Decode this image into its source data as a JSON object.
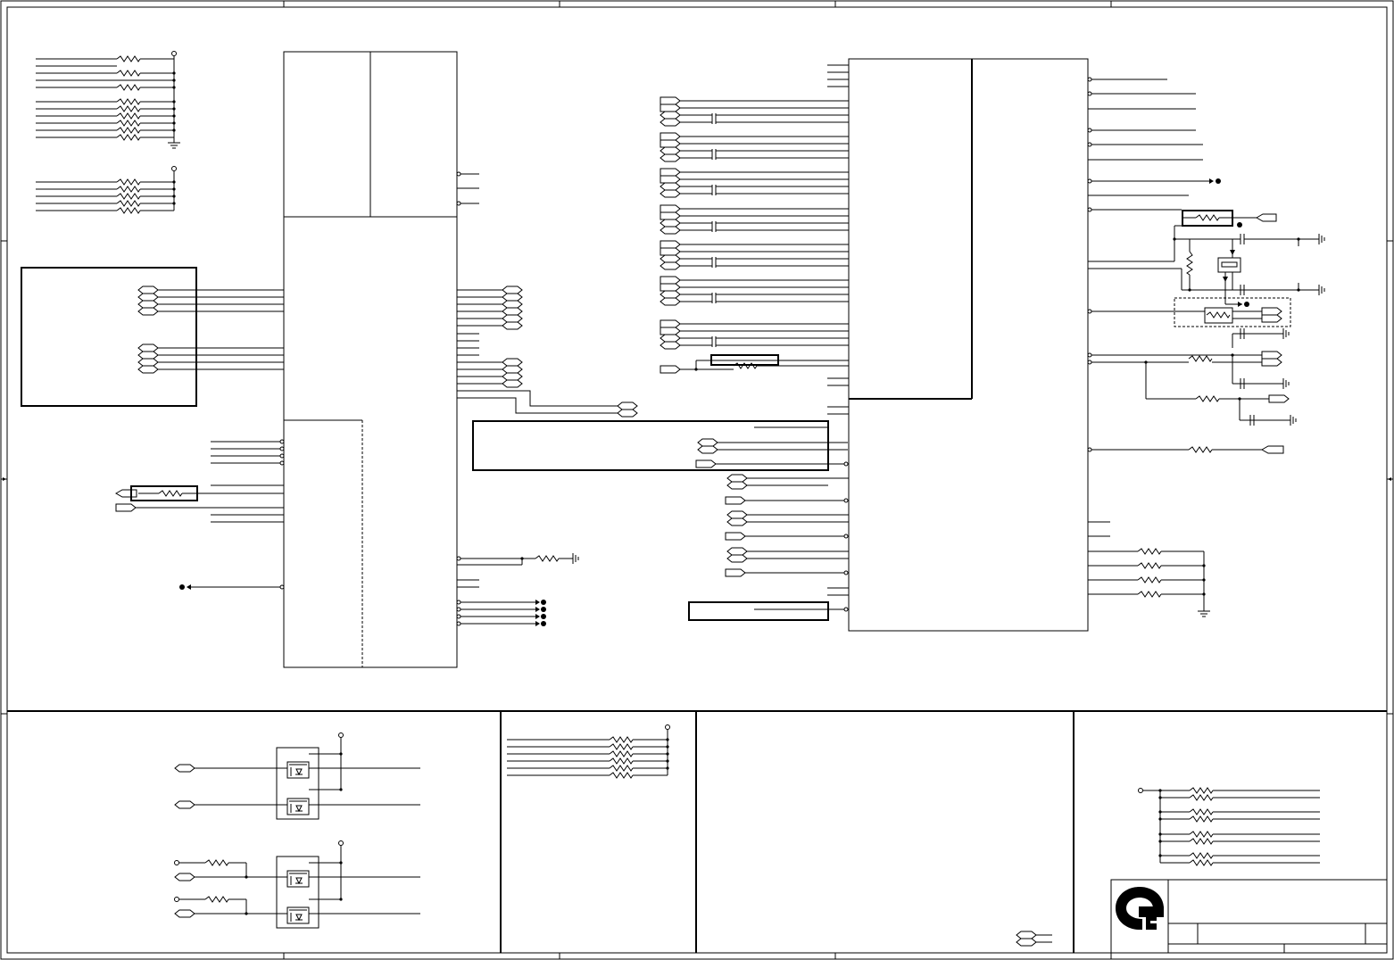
{
  "drawing": {
    "ink": "#000000",
    "paper": "#ffffff",
    "text": {}
  },
  "chart_data": {
    "type": "diagram",
    "kind": "electronic schematic sheet",
    "labels": []
  }
}
